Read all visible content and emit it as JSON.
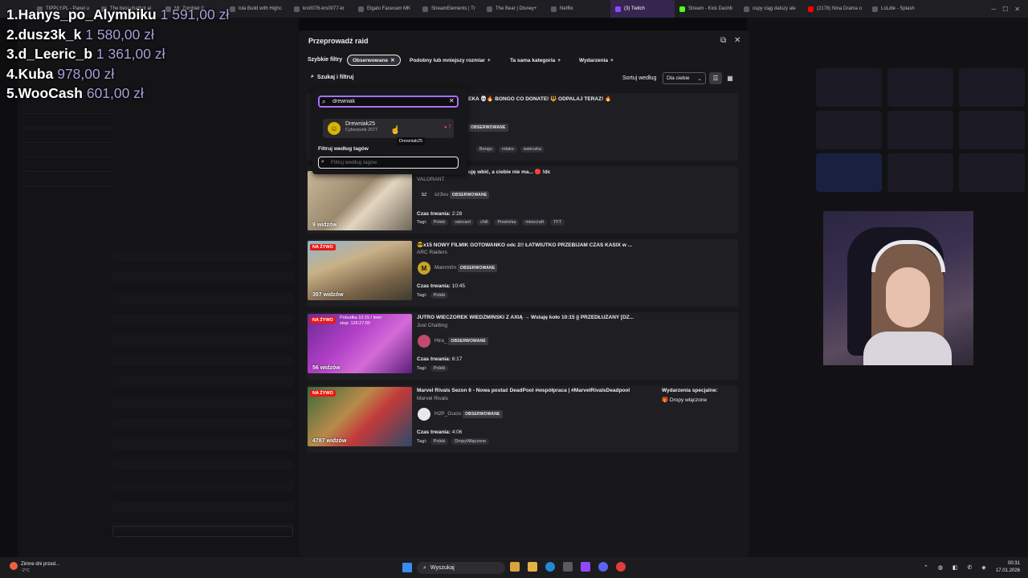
{
  "browser": {
    "tabs": [
      "TIPPLY.PL - Panel u",
      "The best chatbot ai",
      "Mr. Zombiet 0",
      "lola Build with Highc",
      "krx0076-krs0077-kr",
      "Elgato Facecam MK",
      "StreamElements | Tr",
      "The Bear | Disney+",
      "Netflix",
      "(3) Twitch",
      "Stream - Kick Dashb",
      "ospy ciąg dalszy ale",
      "(2178) Nina Drama o",
      "LoLdle - Splash"
    ]
  },
  "leaderboard": [
    {
      "rank": "1.",
      "name": "Hanys_po_Alymbiku",
      "amount": " 1 591,00 zł"
    },
    {
      "rank": "2.",
      "name": "dusz3k_k",
      "amount": " 1 580,00 zł"
    },
    {
      "rank": "3.",
      "name": "d_Leeric_b",
      "amount": " 1 361,00 zł"
    },
    {
      "rank": "4.",
      "name": "Kuba",
      "amount": " 978,00 zł"
    },
    {
      "rank": "5.",
      "name": "WooCash",
      "amount": " 601,00 zł"
    }
  ],
  "raid": {
    "title": "Przeprowadź raid",
    "quick_filters_label": "Szybkie filtry",
    "chips": [
      "Obserwowane",
      "Podobny lub mniejszy rozmiar",
      "Ta sama kategoria",
      "Wydarzenia"
    ],
    "search_filter_label": "Szukaj i filtruj",
    "sort_label": "Sortuj według",
    "sort_value": "Dla ciebie",
    "observed_badge": "OBSERWOWANE",
    "live_badge": "NA ŻYWO",
    "duration_label": "Czas trwania:",
    "tags_label": "Tagi:",
    "cards": [
      {
        "title": "EKA 💀🔥 BONGO CO DONATE! 🔱 ODPALAJ TERAZ! 🔥",
        "tags": [
          "Bongo",
          "relaks",
          "swieczka"
        ]
      },
      {
        "title": "uję wbić, a ciebie nie ma... 🔴 !dc",
        "category": "VALORANT",
        "channel": "sz3vu",
        "viewers": "9 widzów",
        "duration": "2:28",
        "tags": [
          "Polski",
          "valorant",
          "chill",
          "Powtórka",
          "minecraft",
          "TFT"
        ]
      },
      {
        "title": "😎x15 NOWY FILMIK GOTOWANKO odc 2!! ŁATWIUTKO PRZEBIJAM CZAS KASIX w ...",
        "category": "ARC Raiders",
        "channel": "Mamm0n",
        "viewers": "397 widzów",
        "duration": "10:45",
        "tags": [
          "Polski"
        ]
      },
      {
        "title": "JUTRO WIECZOREK WIEDŹMIŃSKI Z AXIĄ → Wstaję koło 10:15 || PRZEDŁUŻANY [DZ...",
        "category": "Just Chatting",
        "channel": "Hira_",
        "viewers": "56 widzów",
        "duration": "6:17",
        "tags": [
          "Polski"
        ],
        "overlay": "Pobudka 10:15 / imer stop: 126:27:00"
      },
      {
        "title": "Marvel Rivals Sezon 6 - Nowa postać DeadPool #współpraca | #MarvelRivalsDeadpool",
        "category": "Marvel Rivals",
        "channel": "H2P_Gucio",
        "viewers": "4787 widzów",
        "duration": "4:06",
        "tags": [
          "Polski",
          "DropyWłączone"
        ]
      }
    ],
    "special_events_label": "Wydarzenia specjalne:",
    "drops_label": "Dropy włączone"
  },
  "search": {
    "value": "drewniak",
    "result_name": "Drewniak25",
    "result_game": "Cyberpunk 2077",
    "result_count": "7",
    "tooltip": "Drewniak25",
    "tag_filter_label": "Filtruj według tagów",
    "tag_placeholder": "Filtruj według tagów"
  },
  "taskbar": {
    "weather": "Zimne dni przed...",
    "weather_temp": "-2°C",
    "search_label": "Wyszukaj",
    "time": "00:31",
    "date": "17.01.2026"
  },
  "colors": {
    "accent": "#a970ff",
    "live": "#e91916",
    "twitch": "#9147ff"
  }
}
